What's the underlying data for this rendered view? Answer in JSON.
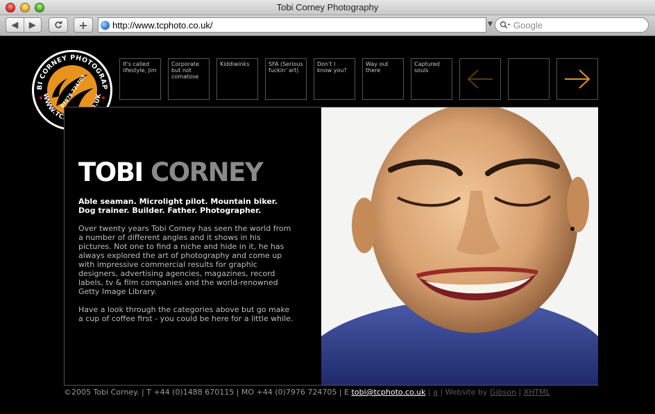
{
  "window": {
    "title": "Tobi Corney Photography"
  },
  "toolbar": {
    "back_icon": "back-arrow-icon",
    "forward_icon": "forward-arrow-icon",
    "reload_icon": "reload-icon",
    "add_icon": "plus-icon",
    "url": "http://www.tcphoto.co.uk/",
    "search_placeholder": "Google"
  },
  "logo": {
    "text_top": "TOBI CORNEY PHOTOGRAPHY",
    "text_bottom": "WWW.TCPHOTO.CO.UK",
    "phone": "07976 724705",
    "accent": "#e8931e"
  },
  "nav": {
    "items": [
      {
        "label": "It's called lifestyle, jim"
      },
      {
        "label": "Corporate but not comatose"
      },
      {
        "label": "Kiddiwinks"
      },
      {
        "label": "SFA (Serious fuckin' art)"
      },
      {
        "label": "Don't I know you?"
      },
      {
        "label": "Way out there"
      },
      {
        "label": "Captured souls"
      }
    ],
    "prev_icon": "left-arrow-icon",
    "next_icon": "right-arrow-icon",
    "prev_color": "#5a3a10",
    "next_color": "#e8931e"
  },
  "main": {
    "name_first": "TOBI",
    "name_last": "CORNEY",
    "tagline": "Able seaman. Microlight pilot. Mountain biker. Dog trainer. Builder. Father. Photographer.",
    "paragraph1": "Over twenty years Tobi Corney has seen the world from a number of different angles and it shows in his pictures. Not one to find a niche and hide in it, he has always explored the art of photography and come up with impressive commercial results for graphic designers, advertising agencies, magazines, record labels, tv & film companies and the world-renowned Getty Image Library.",
    "paragraph2": "Have a look through the categories above but go make a cup of coffee first - you could be here for a little while."
  },
  "footer": {
    "copyright": "©2005 Tobi Corney.  |  T +44 (0)1488 670115  |  MO +44 (0)7976 724705  |  E ",
    "email": "tobi@tcphoto.co.uk",
    "sep1": "  |  ",
    "a_link": "a",
    "sep2": "  |  Website by ",
    "credit_link": "Gibson",
    "sep3": "  |  ",
    "xhtml_link": "XHTML"
  }
}
